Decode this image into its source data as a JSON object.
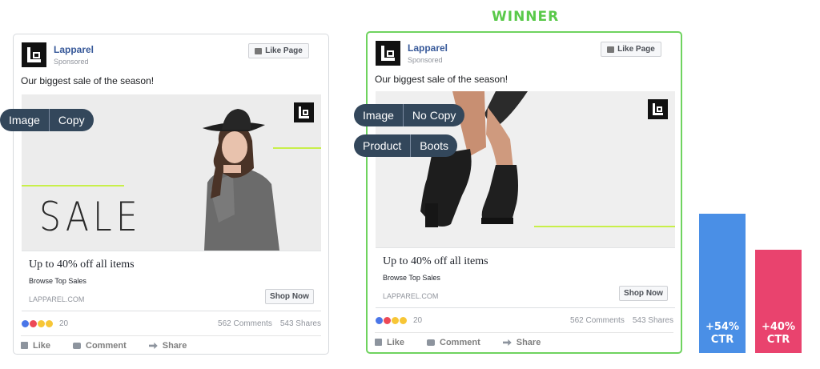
{
  "winner_label": "WINNER",
  "ads": [
    {
      "page_name": "Lapparel",
      "sponsored": "Sponsored",
      "like_page": "Like Page",
      "post_text": "Our biggest sale of the season!",
      "image_overlay_text": "SALE",
      "headline": "Up to 40% off all items",
      "subheadline": "Browse Top Sales",
      "domain": "LAPPAREL.COM",
      "cta": "Shop Now",
      "reaction_count": "20",
      "comments": "562 Comments",
      "shares": "543 Shares",
      "actions": {
        "like": "Like",
        "comment": "Comment",
        "share": "Share"
      }
    },
    {
      "page_name": "Lapparel",
      "sponsored": "Sponsored",
      "like_page": "Like Page",
      "post_text": "Our biggest sale of the season!",
      "headline": "Up to 40% off all items",
      "subheadline": "Browse Top Sales",
      "domain": "LAPPAREL.COM",
      "cta": "Shop Now",
      "reaction_count": "20",
      "comments": "562 Comments",
      "shares": "543 Shares",
      "actions": {
        "like": "Like",
        "comment": "Comment",
        "share": "Share"
      }
    }
  ],
  "tags": {
    "ad_a": [
      [
        "Image",
        "Copy"
      ]
    ],
    "ad_b": [
      [
        "Image",
        "No Copy"
      ],
      [
        "Product",
        "Boots"
      ]
    ]
  },
  "ctr_bars": [
    {
      "label_value": "+54%",
      "label_unit": "CTR",
      "relative_height": 1.0,
      "color": "#4a8fe6"
    },
    {
      "label_value": "+40%",
      "label_unit": "CTR",
      "relative_height": 0.74,
      "color": "#e9436e"
    }
  ],
  "colors": {
    "winner_green": "#5ac94a",
    "facebook_blue": "#365899",
    "tag_bg": "#33475b"
  }
}
